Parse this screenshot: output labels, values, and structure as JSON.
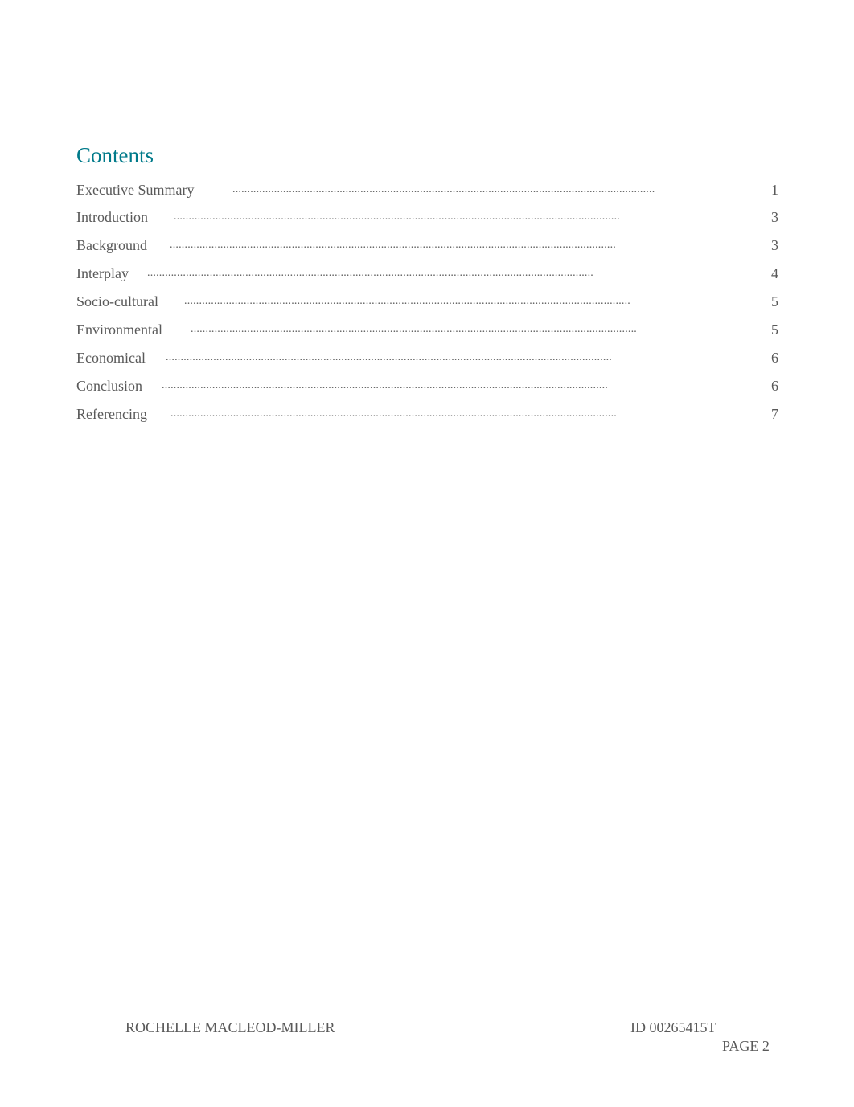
{
  "document": {
    "toc_title": "Contents",
    "toc_entries": [
      {
        "label": "Executive Summary",
        "page": "1"
      },
      {
        "label": "Introduction",
        "page": "3"
      },
      {
        "label": "Background",
        "page": "3"
      },
      {
        "label": "Interplay",
        "page": "4"
      },
      {
        "label": "Socio-cultural",
        "page": "5"
      },
      {
        "label": "Environmental",
        "page": "5"
      },
      {
        "label": "Economical",
        "page": "6"
      },
      {
        "label": "Conclusion",
        "page": "6"
      },
      {
        "label": "Referencing",
        "page": "7"
      }
    ],
    "dot_leader": "......................................................................................................................................................",
    "footer": {
      "author": "ROCHELLE MACLEOD-MILLER",
      "student_id": "ID 00265415T",
      "page_label": "PAGE 2"
    }
  }
}
